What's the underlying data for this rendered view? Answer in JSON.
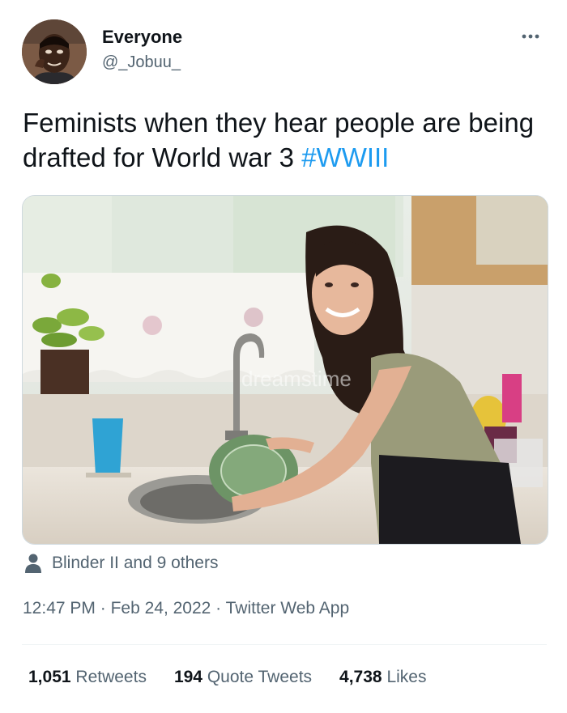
{
  "author": {
    "display_name": "Everyone",
    "handle": "@_Jobuu_"
  },
  "tweet": {
    "text": "Feminists when they hear people are being drafted for World war 3 ",
    "hashtag": "#WWIII"
  },
  "media": {
    "watermark": "dreamstime"
  },
  "tagged": {
    "label": "Blinder II and 9 others"
  },
  "meta": {
    "time": "12:47 PM",
    "separator": " · ",
    "date": "Feb 24, 2022",
    "source": "Twitter Web App"
  },
  "stats": {
    "retweets_count": "1,051",
    "retweets_label": "Retweets",
    "quotes_count": "194",
    "quotes_label": "Quote Tweets",
    "likes_count": "4,738",
    "likes_label": "Likes"
  },
  "icons": {
    "more": "more-options-icon",
    "person": "person-icon"
  },
  "colors": {
    "link": "#1d9bf0",
    "secondary_text": "#536471",
    "border": "#cfd9de"
  }
}
